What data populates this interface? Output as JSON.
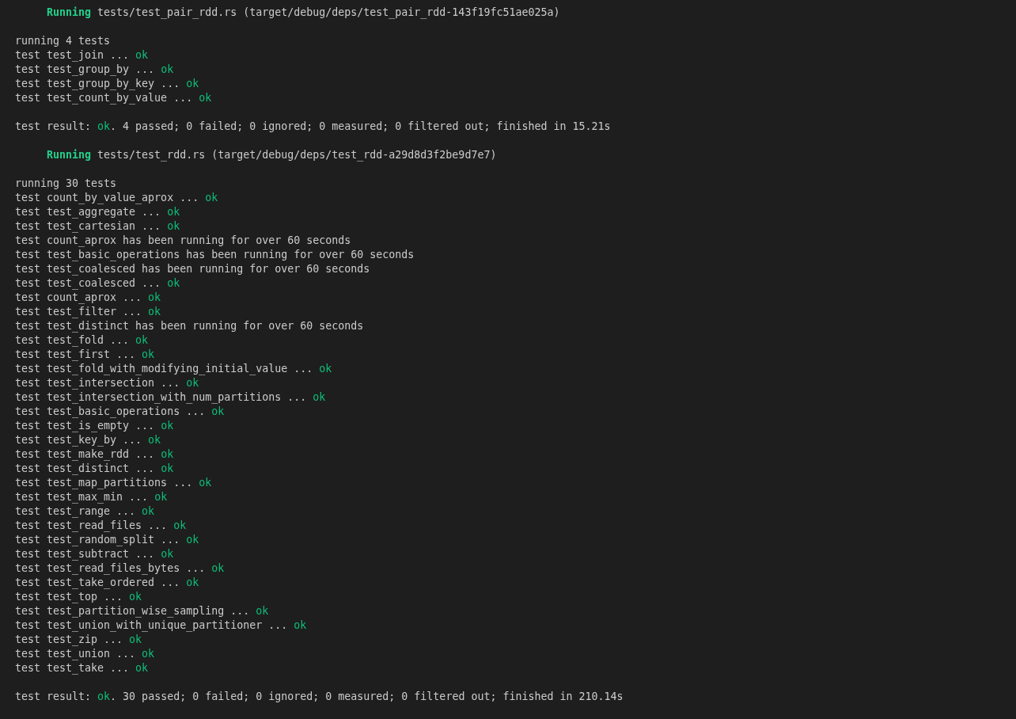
{
  "sections": [
    {
      "running_label": "Running",
      "target": "tests/test_pair_rdd.rs (target/debug/deps/test_pair_rdd-143f19fc51ae025a)",
      "header": "running 4 tests",
      "lines": [
        {
          "kind": "result",
          "text": "test test_join ...",
          "status": "ok"
        },
        {
          "kind": "result",
          "text": "test test_group_by ...",
          "status": "ok"
        },
        {
          "kind": "result",
          "text": "test test_group_by_key ...",
          "status": "ok"
        },
        {
          "kind": "result",
          "text": "test test_count_by_value ...",
          "status": "ok"
        }
      ],
      "summary": {
        "prefix": "test result:",
        "status": "ok",
        "rest": ". 4 passed; 0 failed; 0 ignored; 0 measured; 0 filtered out; finished in 15.21s"
      }
    },
    {
      "running_label": "Running",
      "target": "tests/test_rdd.rs (target/debug/deps/test_rdd-a29d8d3f2be9d7e7)",
      "header": "running 30 tests",
      "lines": [
        {
          "kind": "result",
          "text": "test count_by_value_aprox ...",
          "status": "ok"
        },
        {
          "kind": "result",
          "text": "test test_aggregate ...",
          "status": "ok"
        },
        {
          "kind": "result",
          "text": "test test_cartesian ...",
          "status": "ok"
        },
        {
          "kind": "note",
          "text": "test count_aprox has been running for over 60 seconds"
        },
        {
          "kind": "note",
          "text": "test test_basic_operations has been running for over 60 seconds"
        },
        {
          "kind": "note",
          "text": "test test_coalesced has been running for over 60 seconds"
        },
        {
          "kind": "result",
          "text": "test test_coalesced ...",
          "status": "ok"
        },
        {
          "kind": "result",
          "text": "test count_aprox ...",
          "status": "ok"
        },
        {
          "kind": "result",
          "text": "test test_filter ...",
          "status": "ok"
        },
        {
          "kind": "note",
          "text": "test test_distinct has been running for over 60 seconds"
        },
        {
          "kind": "result",
          "text": "test test_fold ...",
          "status": "ok"
        },
        {
          "kind": "result",
          "text": "test test_first ...",
          "status": "ok"
        },
        {
          "kind": "result",
          "text": "test test_fold_with_modifying_initial_value ...",
          "status": "ok"
        },
        {
          "kind": "result",
          "text": "test test_intersection ...",
          "status": "ok"
        },
        {
          "kind": "result",
          "text": "test test_intersection_with_num_partitions ...",
          "status": "ok"
        },
        {
          "kind": "result",
          "text": "test test_basic_operations ...",
          "status": "ok"
        },
        {
          "kind": "result",
          "text": "test test_is_empty ...",
          "status": "ok"
        },
        {
          "kind": "result",
          "text": "test test_key_by ...",
          "status": "ok"
        },
        {
          "kind": "result",
          "text": "test test_make_rdd ...",
          "status": "ok"
        },
        {
          "kind": "result",
          "text": "test test_distinct ...",
          "status": "ok"
        },
        {
          "kind": "result",
          "text": "test test_map_partitions ...",
          "status": "ok"
        },
        {
          "kind": "result",
          "text": "test test_max_min ...",
          "status": "ok"
        },
        {
          "kind": "result",
          "text": "test test_range ...",
          "status": "ok"
        },
        {
          "kind": "result",
          "text": "test test_read_files ...",
          "status": "ok"
        },
        {
          "kind": "result",
          "text": "test test_random_split ...",
          "status": "ok"
        },
        {
          "kind": "result",
          "text": "test test_subtract ...",
          "status": "ok"
        },
        {
          "kind": "result",
          "text": "test test_read_files_bytes ...",
          "status": "ok"
        },
        {
          "kind": "result",
          "text": "test test_take_ordered ...",
          "status": "ok"
        },
        {
          "kind": "result",
          "text": "test test_top ...",
          "status": "ok"
        },
        {
          "kind": "result",
          "text": "test test_partition_wise_sampling ...",
          "status": "ok"
        },
        {
          "kind": "result",
          "text": "test test_union_with_unique_partitioner ...",
          "status": "ok"
        },
        {
          "kind": "result",
          "text": "test test_zip ...",
          "status": "ok"
        },
        {
          "kind": "result",
          "text": "test test_union ...",
          "status": "ok"
        },
        {
          "kind": "result",
          "text": "test test_take ...",
          "status": "ok"
        }
      ],
      "summary": {
        "prefix": "test result:",
        "status": "ok",
        "rest": ". 30 passed; 0 failed; 0 ignored; 0 measured; 0 filtered out; finished in 210.14s"
      }
    }
  ]
}
